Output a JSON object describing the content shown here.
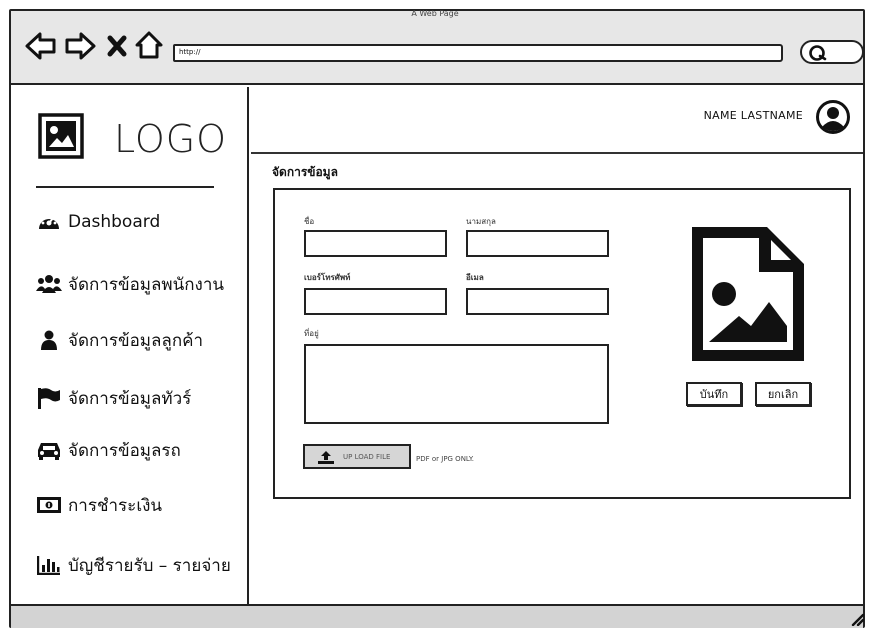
{
  "window": {
    "title": "A Web Page"
  },
  "browser": {
    "url": "http://",
    "nav_icons": [
      "back-arrow-icon",
      "forward-arrow-icon",
      "close-x-icon",
      "home-icon"
    ],
    "search_icon": "search-icon"
  },
  "sidebar": {
    "logo_text": "LOGO",
    "logo_icon": "image-icon",
    "items": [
      {
        "label": "Dashboard",
        "icon": "dashboard-gauge-icon"
      },
      {
        "label": "จัดการข้อมูลพนักงาน",
        "icon": "users-icon"
      },
      {
        "label": "จัดการข้อมูลลูกค้า",
        "icon": "user-icon"
      },
      {
        "label": "จัดการข้อมูลทัวร์",
        "icon": "flag-icon"
      },
      {
        "label": "จัดการข้อมูลรถ",
        "icon": "car-icon"
      },
      {
        "label": "การชำระเงิน",
        "icon": "money-icon"
      },
      {
        "label": "บัญชีรายรับ – รายจ่าย",
        "icon": "bar-chart-icon"
      }
    ]
  },
  "header": {
    "username": "NAME LASTNAME",
    "avatar_icon": "user-circle-icon"
  },
  "main": {
    "section_title": "จัดการข้อมูล",
    "form": {
      "first_name_label": "ชื่อ",
      "last_name_label": "นามสกุล",
      "phone_label": "เบอร์โทรศัพท์",
      "email_label": "อีเมล",
      "address_label": "ที่อยู่",
      "first_name_value": "",
      "last_name_value": "",
      "phone_value": "",
      "email_value": "",
      "address_value": ""
    },
    "upload_button": "UP LOAD FILE",
    "upload_note": "PDF or JPG ONLY.",
    "save_button": "บันทึก",
    "cancel_button": "ยกเลิก",
    "preview_icon": "image-file-icon"
  }
}
